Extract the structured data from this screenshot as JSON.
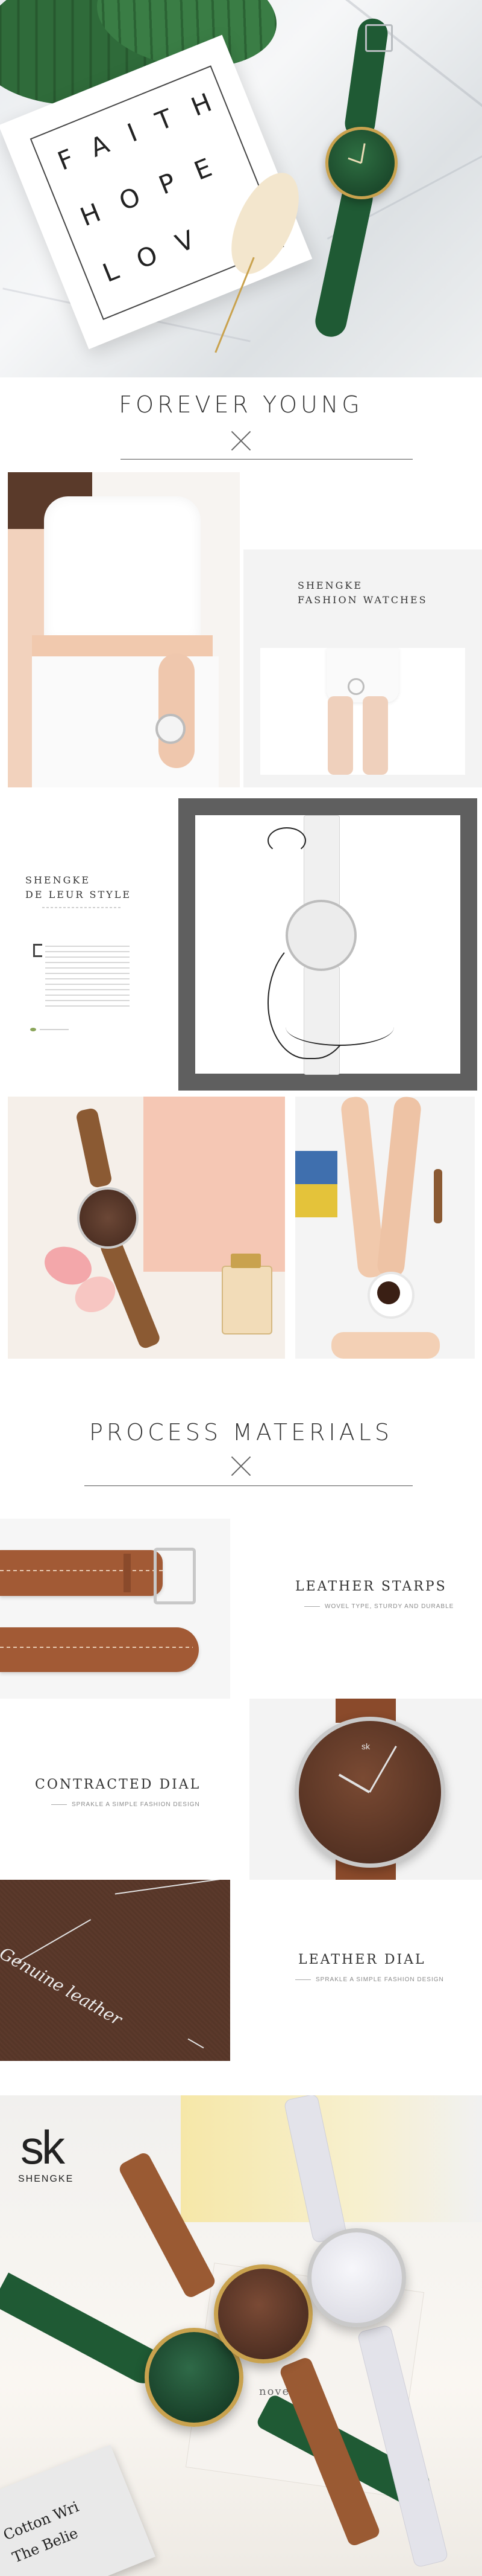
{
  "hero": {
    "card_lines": [
      "FAITH",
      "HOPE",
      "LOV"
    ]
  },
  "forever": {
    "title": "FOREVER YOUNG"
  },
  "fashion": {
    "brand": "SHENGKE",
    "subtitle": "FASHION WATCHES"
  },
  "deleur": {
    "brand": "SHENGKE",
    "subtitle": "DE LEUR STYLE"
  },
  "process": {
    "title": "PROCESS MATERIALS",
    "leather_straps": {
      "title": "LEATHER STARPS",
      "caption": "WOVEL TYPE, STURDY AND DURABLE"
    },
    "contracted_dial": {
      "title": "CONTRACTED DIAL",
      "caption": "SPRAKLE A SIMPLE FASHION DESIGN"
    },
    "leather_dial": {
      "title": "LEATHER DIAL",
      "caption": "SPRAKLE A SIMPLE FASHION DESIGN",
      "photo_text": "Genuine leather"
    }
  },
  "bottom": {
    "logo_mark": "sk",
    "logo_name": "SHENGKE",
    "book_text": [
      "Cotton Wri",
      "The Belie"
    ],
    "paper_text": "nove"
  },
  "colors": {
    "watch_green": "#1f5a34",
    "watch_brown": "#7a4a2f",
    "strap_tan": "#a35b34",
    "rose_gold": "#c9a24e",
    "white_strap": "#e8e8ee"
  }
}
